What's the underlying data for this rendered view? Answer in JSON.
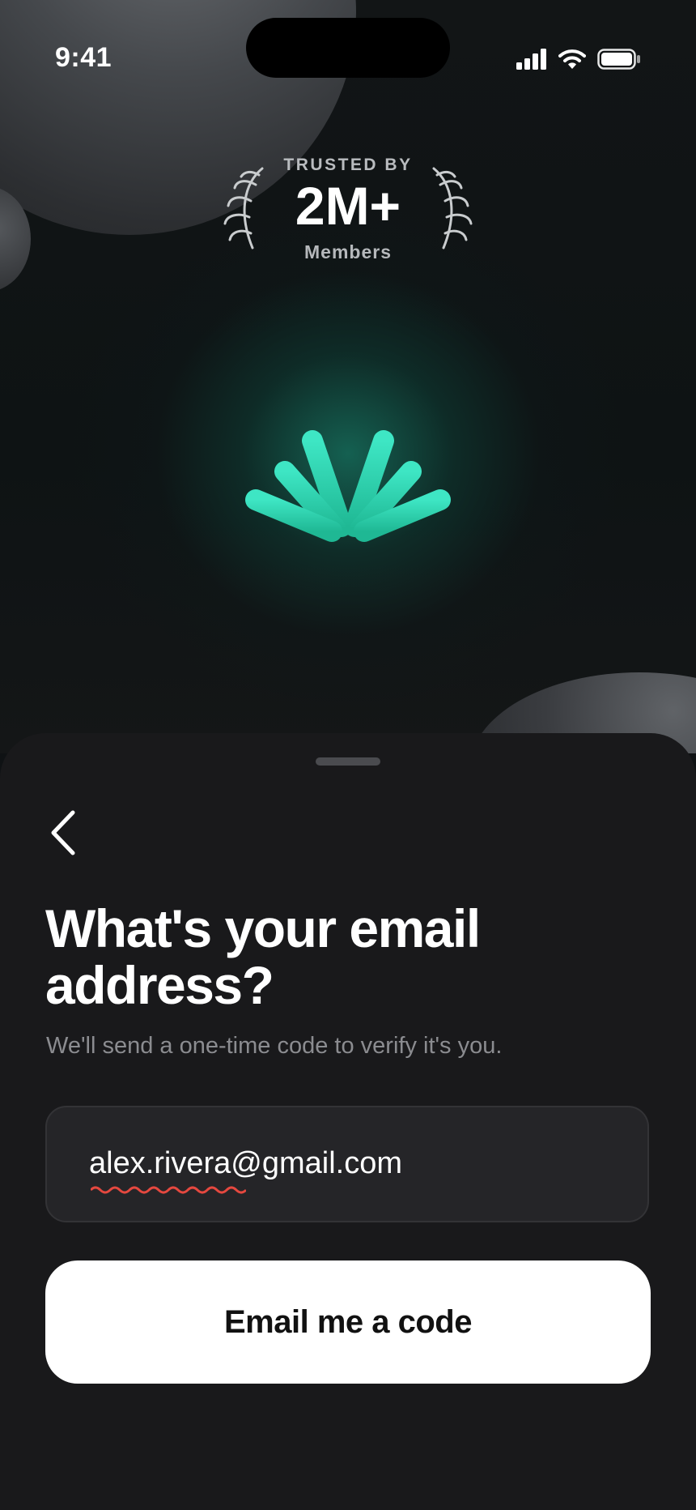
{
  "status_bar": {
    "time": "9:41",
    "icons": [
      "cellular-signal-icon",
      "wifi-icon",
      "battery-icon"
    ]
  },
  "hero": {
    "trusted_label": "TRUSTED BY",
    "member_count": "2M+",
    "members_label": "Members",
    "logo_icon": "fan-logo-icon",
    "accent_color": "#2ed6b4"
  },
  "sheet": {
    "back_icon": "chevron-left-icon",
    "title": "What's your email address?",
    "subtitle": "We'll send a one-time code to verify it's you.",
    "email_input": {
      "value": "alex.rivera@gmail.com"
    },
    "submit_label": "Email me a code"
  }
}
